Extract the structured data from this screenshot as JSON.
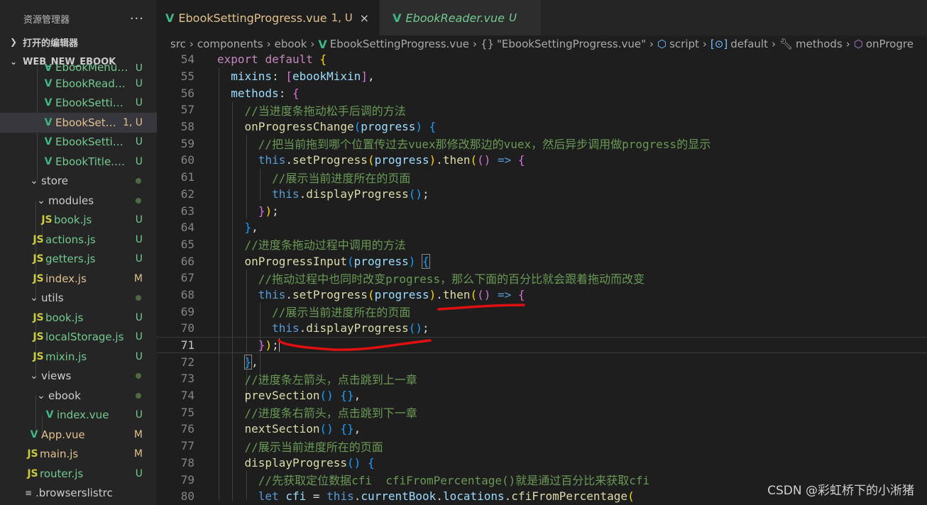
{
  "sidebar": {
    "title": "资源管理器",
    "more": "···",
    "open_editors": "打开的编辑器",
    "project": "WEB_NEW_EBOOK",
    "files": [
      {
        "name": "EbookMenu.vue",
        "badge": "U",
        "type": "vue"
      },
      {
        "name": "EbookReader.vue",
        "badge": "U",
        "type": "vue"
      },
      {
        "name": "EbookSettingFont.vue",
        "badge": "U",
        "type": "vue"
      },
      {
        "name": "EbookSettingProgress.vue",
        "badge": "1, U",
        "type": "vue",
        "active": true
      },
      {
        "name": "EbookSettingTheme.vue",
        "badge": "U",
        "type": "vue"
      },
      {
        "name": "EbookTitle.vue",
        "badge": "U",
        "type": "vue"
      },
      {
        "name": "store",
        "type": "folder"
      },
      {
        "name": "modules",
        "type": "folder"
      },
      {
        "name": "book.js",
        "badge": "U",
        "type": "js"
      },
      {
        "name": "actions.js",
        "badge": "U",
        "type": "js"
      },
      {
        "name": "getters.js",
        "badge": "U",
        "type": "js"
      },
      {
        "name": "index.js",
        "badge": "M",
        "type": "js"
      },
      {
        "name": "utils",
        "type": "folder"
      },
      {
        "name": "book.js",
        "badge": "U",
        "type": "js"
      },
      {
        "name": "localStorage.js",
        "badge": "U",
        "type": "js"
      },
      {
        "name": "mixin.js",
        "badge": "U",
        "type": "js"
      },
      {
        "name": "views",
        "type": "folder"
      },
      {
        "name": "ebook",
        "type": "folder"
      },
      {
        "name": "index.vue",
        "badge": "U",
        "type": "vue"
      },
      {
        "name": "App.vue",
        "badge": "M",
        "type": "vue"
      },
      {
        "name": "main.js",
        "badge": "M",
        "type": "js"
      },
      {
        "name": "router.js",
        "badge": "U",
        "type": "js"
      },
      {
        "name": ".browserslistrc",
        "type": "other"
      }
    ]
  },
  "tabs": [
    {
      "label": "EbookSettingProgress.vue",
      "status": "1, U",
      "close": "×"
    },
    {
      "label": "EbookReader.vue",
      "status": "U"
    }
  ],
  "breadcrumb": [
    "src",
    "components",
    "ebook",
    "EbookSettingProgress.vue",
    "\"EbookSettingProgress.vue\"",
    "script",
    "default",
    "methods",
    "onProgre"
  ],
  "lines": [
    "54",
    "55",
    "56",
    "57",
    "58",
    "59",
    "60",
    "61",
    "62",
    "63",
    "64",
    "65",
    "66",
    "67",
    "68",
    "69",
    "70",
    "71",
    "72",
    "73",
    "74",
    "75",
    "76",
    "77",
    "78",
    "79",
    "80"
  ],
  "comments": {
    "c57": "//当进度条拖动松手后调的方法",
    "c59": "//把当前拖到哪个位置传过去vuex那修改那边的vuex，然后异步调用做progress的显示",
    "c61": "//展示当前进度所在的页面",
    "c65": "//进度条拖动过程中调用的方法",
    "c67": "//拖动过程中也同时改变progress，那么下面的百分比就会跟着拖动而改变",
    "c69": "//展示当前进度所在的页面",
    "c73": "//进度条左箭头，点击跳到上一章",
    "c75": "//进度条右箭头，点击跳到下一章",
    "c77": "//展示当前进度所在的页面",
    "c79": "//先获取定位数据cfi  cfiFromPercentage()就是通过百分比来获取cfi"
  },
  "watermark": "CSDN @彩虹桥下的小淅猪"
}
